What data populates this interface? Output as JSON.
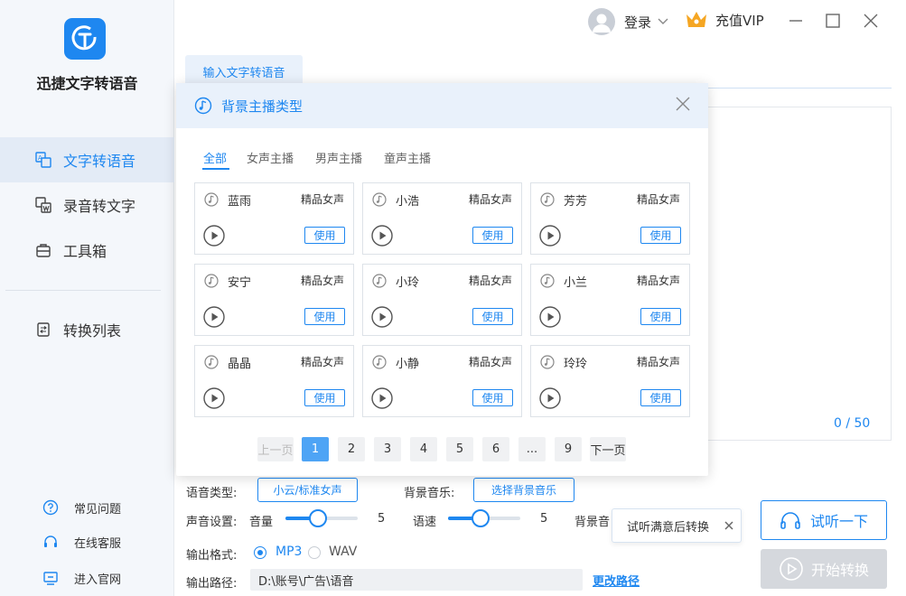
{
  "app": {
    "name": "迅捷文字转语音"
  },
  "sidebar": {
    "items": [
      {
        "label": "文字转语音",
        "icon": "translate-icon"
      },
      {
        "label": "录音转文字",
        "icon": "recording-text-icon"
      },
      {
        "label": "工具箱",
        "icon": "toolbox-icon"
      },
      {
        "label": "转换列表",
        "icon": "list-icon"
      }
    ],
    "footer": [
      {
        "label": "常见问题",
        "icon": "question-icon"
      },
      {
        "label": "在线客服",
        "icon": "headset-icon"
      },
      {
        "label": "进入官网",
        "icon": "monitor-icon"
      }
    ]
  },
  "header": {
    "login": "登录",
    "vip": "充值VIP"
  },
  "main": {
    "tab": "输入文字转语音",
    "counter": "0 / 50"
  },
  "settings": {
    "voice_type_label": "语音类型:",
    "voice_type_value": "小云/标准女声",
    "bg_music_label": "背景音乐:",
    "bg_music_button": "选择背景音乐",
    "sound_label": "声音设置:",
    "volume_label": "音量",
    "volume_value": "5",
    "speed_label": "语速",
    "speed_value": "5",
    "bg_partial_label": "背景音",
    "format_label": "输出格式:",
    "format_options": [
      "MP3",
      "WAV"
    ],
    "format_selected": "MP3",
    "path_label": "输出路径:",
    "path_value": "D:\\账号\\广告\\语音",
    "change_path": "更改路径"
  },
  "tooltip": {
    "text": "试听满意后转换"
  },
  "actions": {
    "try": "试听一下",
    "convert": "开始转换"
  },
  "modal": {
    "title": "背景主播类型",
    "tabs": [
      "全部",
      "女声主播",
      "男声主播",
      "童声主播"
    ],
    "active_tab": "全部",
    "cards": [
      {
        "name": "蓝雨",
        "tag": "精品女声",
        "use": "使用"
      },
      {
        "name": "小浩",
        "tag": "精品女声",
        "use": "使用"
      },
      {
        "name": "芳芳",
        "tag": "精品女声",
        "use": "使用"
      },
      {
        "name": "安宁",
        "tag": "精品女声",
        "use": "使用"
      },
      {
        "name": "小玲",
        "tag": "精品女声",
        "use": "使用"
      },
      {
        "name": "小兰",
        "tag": "精品女声",
        "use": "使用"
      },
      {
        "name": "晶晶",
        "tag": "精品女声",
        "use": "使用"
      },
      {
        "name": "小静",
        "tag": "精品女声",
        "use": "使用"
      },
      {
        "name": "玲玲",
        "tag": "精品女声",
        "use": "使用"
      }
    ],
    "pagination": {
      "prev": "上一页",
      "pages": [
        "1",
        "2",
        "3",
        "4",
        "5",
        "6",
        "...",
        "9"
      ],
      "current": "1",
      "next": "下一页"
    }
  },
  "colors": {
    "accent": "#1e87f0",
    "vip_crown": "#f5a623",
    "disabled": "#d5d8dd"
  }
}
